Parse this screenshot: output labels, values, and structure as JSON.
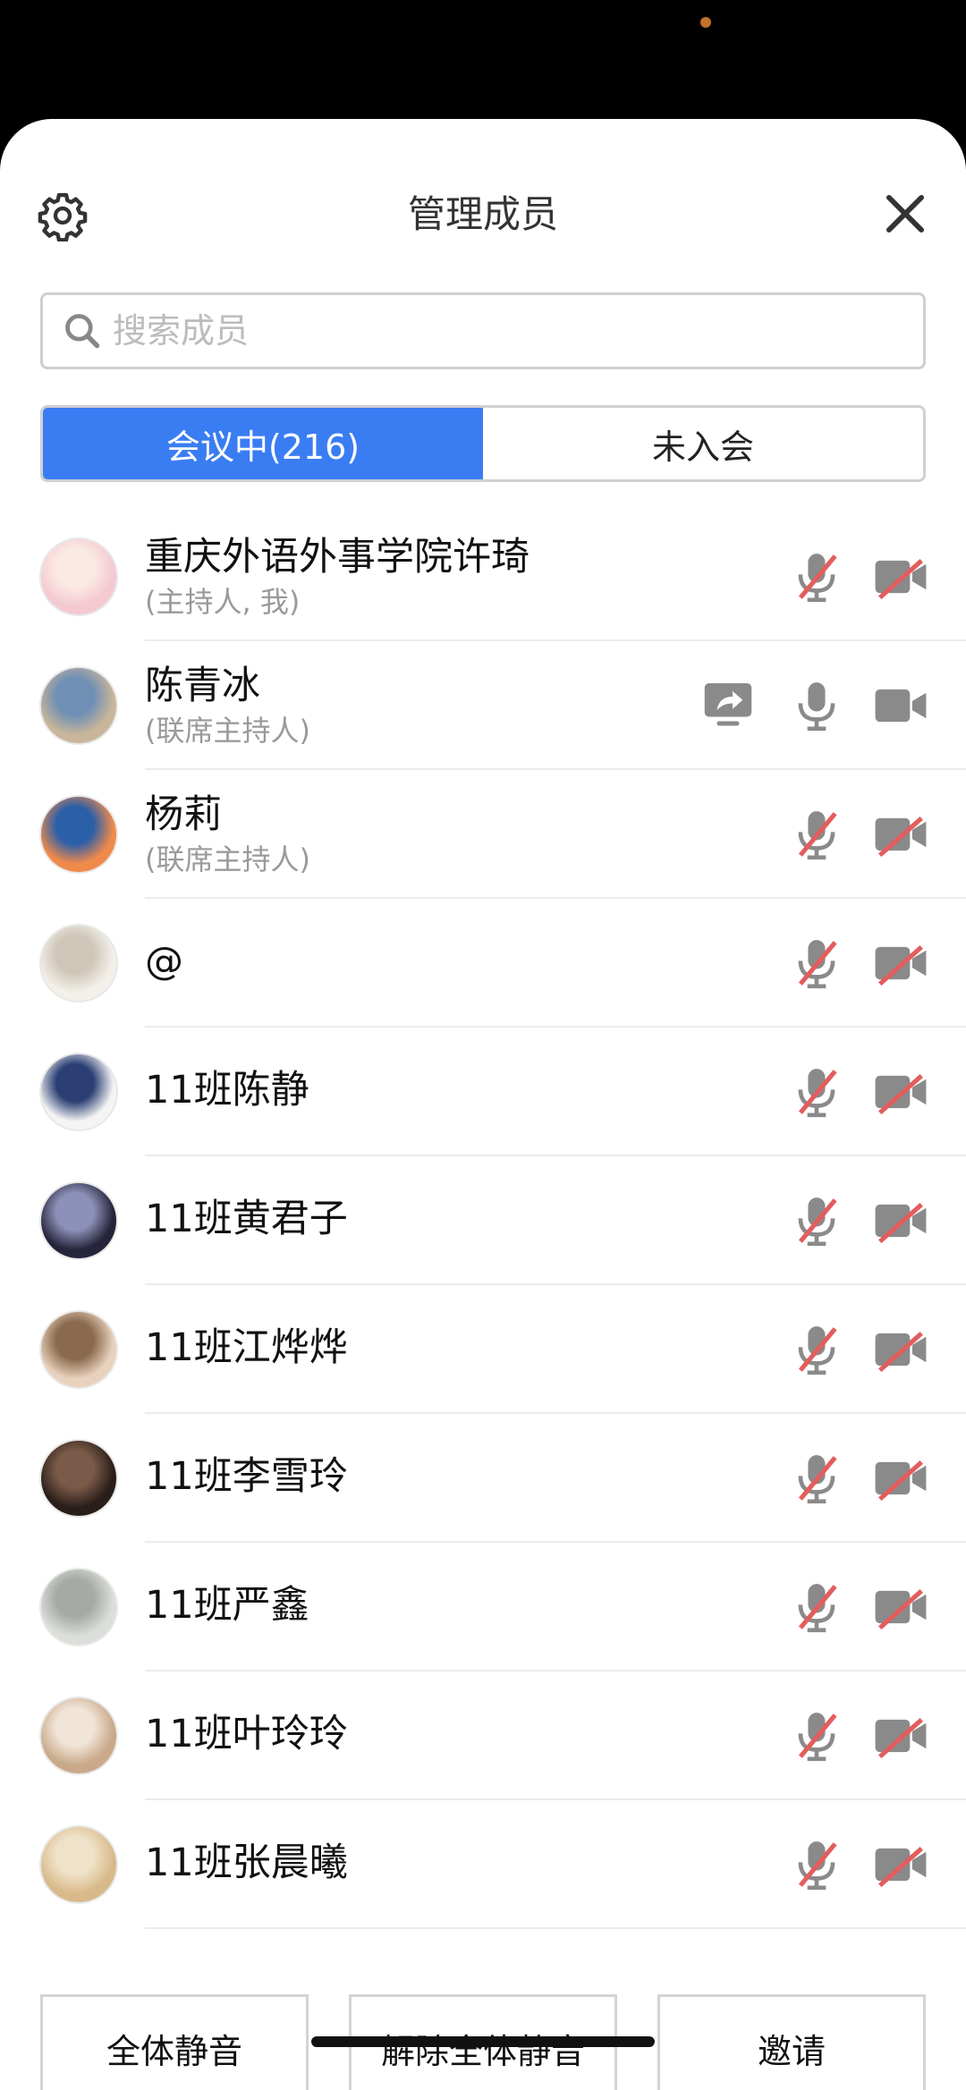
{
  "header": {
    "title": "管理成员"
  },
  "search": {
    "placeholder": "搜索成员"
  },
  "tabs": [
    {
      "label": "会议中(216)",
      "active": true
    },
    {
      "label": "未入会",
      "active": false
    }
  ],
  "members": [
    {
      "name": "重庆外语外事学院许琦",
      "role": "(主持人, 我)",
      "mic": "off",
      "camera": "off",
      "sharing": false,
      "avatar_colors": [
        "#f4c9d2",
        "#fbeae4"
      ]
    },
    {
      "name": "陈青冰",
      "role": "(联席主持人)",
      "mic": "on",
      "camera": "on",
      "sharing": true,
      "avatar_colors": [
        "#c9b69a",
        "#6f8fb4"
      ]
    },
    {
      "name": "杨莉",
      "role": "(联席主持人)",
      "mic": "off",
      "camera": "off",
      "sharing": false,
      "avatar_colors": [
        "#f08a4a",
        "#2b5fa8"
      ]
    },
    {
      "name": "@",
      "role": "",
      "mic": "off",
      "camera": "off",
      "sharing": false,
      "avatar_colors": [
        "#f3f0ea",
        "#cfc6b8"
      ]
    },
    {
      "name": "11班陈静",
      "role": "",
      "mic": "off",
      "camera": "off",
      "sharing": false,
      "avatar_colors": [
        "#f4f4f4",
        "#2b3f74"
      ]
    },
    {
      "name": "11班黄君子",
      "role": "",
      "mic": "off",
      "camera": "off",
      "sharing": false,
      "avatar_colors": [
        "#26243a",
        "#8d90b8"
      ]
    },
    {
      "name": "11班江烨烨",
      "role": "",
      "mic": "off",
      "camera": "off",
      "sharing": false,
      "avatar_colors": [
        "#e9d2bd",
        "#8a6a4e"
      ]
    },
    {
      "name": "11班李雪玲",
      "role": "",
      "mic": "off",
      "camera": "off",
      "sharing": false,
      "avatar_colors": [
        "#2a1e1a",
        "#7a5a48"
      ]
    },
    {
      "name": "11班严鑫",
      "role": "",
      "mic": "off",
      "camera": "off",
      "sharing": false,
      "avatar_colors": [
        "#dcdfd9",
        "#a6aaa4"
      ]
    },
    {
      "name": "11班叶玲玲",
      "role": "",
      "mic": "off",
      "camera": "off",
      "sharing": false,
      "avatar_colors": [
        "#c9a98a",
        "#f1e5d8"
      ]
    },
    {
      "name": "11班张晨曦",
      "role": "",
      "mic": "off",
      "camera": "off",
      "sharing": false,
      "avatar_colors": [
        "#d8b98a",
        "#f0e2c8"
      ]
    }
  ],
  "footer": {
    "mute_all": "全体静音",
    "unmute_all": "解除全体静音",
    "invite": "邀请"
  },
  "colors": {
    "accent": "#3a7df2",
    "muted_slash": "#e35d5d",
    "icon_grey": "#8a8a8a"
  }
}
